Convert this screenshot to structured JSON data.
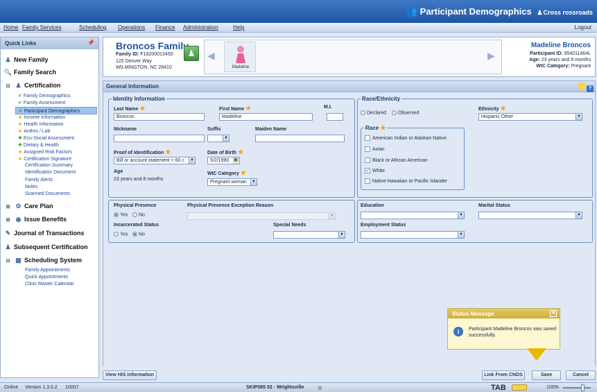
{
  "window": {
    "title": "Participant Demographics",
    "user": "Cross rossroads",
    "logout": "Logout"
  },
  "menu": {
    "items": [
      "Home",
      "Family Services",
      "Scheduling",
      "Operations",
      "Finance",
      "Administration",
      "Help"
    ]
  },
  "sidebar": {
    "header": "Quick Links",
    "new_family": "New Family",
    "family_search": "Family Search",
    "certification": "Certification",
    "cert_items": [
      {
        "label": "Family Demographics",
        "status": "check"
      },
      {
        "label": "Family Assessment",
        "status": "check"
      },
      {
        "label": "Participant Demographics",
        "status": "check"
      },
      {
        "label": "Income Information",
        "status": "star"
      },
      {
        "label": "Health Information",
        "status": "star"
      },
      {
        "label": "Anthro / Lab",
        "status": "star"
      },
      {
        "label": "Eco-Social Assessment",
        "status": "plus"
      },
      {
        "label": "Dietary & Health",
        "status": "plus"
      },
      {
        "label": "Assigned Risk Factors",
        "status": "star"
      },
      {
        "label": "Certification Signature",
        "status": "star"
      },
      {
        "label": "Certification Summary",
        "status": "none"
      },
      {
        "label": "Identification Document",
        "status": "none"
      },
      {
        "label": "Family Alerts",
        "status": "none"
      },
      {
        "label": "Notes",
        "status": "none"
      },
      {
        "label": "Scanned Documents",
        "status": "none"
      }
    ],
    "care_plan": "Care Plan",
    "issue_benefits": "Issue Benefits",
    "journal": "Journal of Transactions",
    "subsequent_cert": "Subsequent Certification",
    "scheduling": "Scheduling System",
    "sched_items": [
      "Family Appointments",
      "Quick Appointments",
      "Clinic Master Calendar"
    ]
  },
  "family": {
    "name": "Broncos Family",
    "id_label": "Family ID:",
    "id": "F18200013450",
    "address": "125 Denver Way",
    "city": "WILMINGTON,   NC  28410",
    "member_name": "Madeline"
  },
  "participant": {
    "name": "Madeline Broncos",
    "id_label": "Participant ID:",
    "id": "954011464L",
    "age_label": "Age:",
    "age": "23 years and 8 months",
    "wic_label": "WIC Category:",
    "wic": "Pregnant"
  },
  "section_title": "General Information",
  "identity": {
    "legend": "Identity Information",
    "last_name_label": "Last Name",
    "last_name": "Broncos",
    "first_name_label": "First Name",
    "first_name": "Madeline",
    "mi_label": "M.I.",
    "mi": "",
    "nickname_label": "Nickname",
    "nickname": "",
    "suffix_label": "Suffix",
    "suffix": "",
    "maiden_label": "Maiden Name",
    "maiden": "",
    "proof_label": "Proof of Identification",
    "proof": "Bill or account statement < 60 c",
    "dob_label": "Date of Birth",
    "dob": "5/2/1990",
    "age_label": "Age",
    "age": "23 years and 8 months",
    "wic_label": "WIC Category",
    "wic": "Pregnant woman"
  },
  "race": {
    "legend": "Race/Ethnicity",
    "declared": "Declared",
    "observed": "Observed",
    "ethnicity_label": "Ethnicity",
    "ethnicity": "Hispanic Other",
    "race_legend": "Race",
    "options": [
      {
        "label": "American Indian or Alaskan Native",
        "checked": false
      },
      {
        "label": "Asian",
        "checked": false
      },
      {
        "label": "Black or African American",
        "checked": false
      },
      {
        "label": "White",
        "checked": true
      },
      {
        "label": "Native Hawaiian or Pacific Islander",
        "checked": false
      }
    ]
  },
  "presence": {
    "physical_label": "Physical Presence",
    "yes": "Yes",
    "no": "No",
    "exception_label": "Physical Presence Exception Reason",
    "incarcerated_label": "Incarcerated Status",
    "special_label": "Special Needs"
  },
  "other": {
    "education_label": "Education",
    "marital_label": "Marital Status",
    "employment_label": "Employment Status"
  },
  "buttons": {
    "view_his": "View HIS Information",
    "link_cnds": "Link From CNDS",
    "save": "Save",
    "cancel": "Cancel"
  },
  "status_message": {
    "title": "Status Message",
    "text": "Participant Madeline Broncos was saved successfully."
  },
  "statusbar": {
    "online": "Online",
    "version": "Version 1.3.0.2",
    "build": "10007",
    "site": "SKIP065 02 - Wrightsville",
    "tab": "TAB",
    "zoom": "100%"
  },
  "colors": {
    "brand": "#1f56a6",
    "required_star": "#f0a400",
    "status_header": "#cfae3c"
  }
}
